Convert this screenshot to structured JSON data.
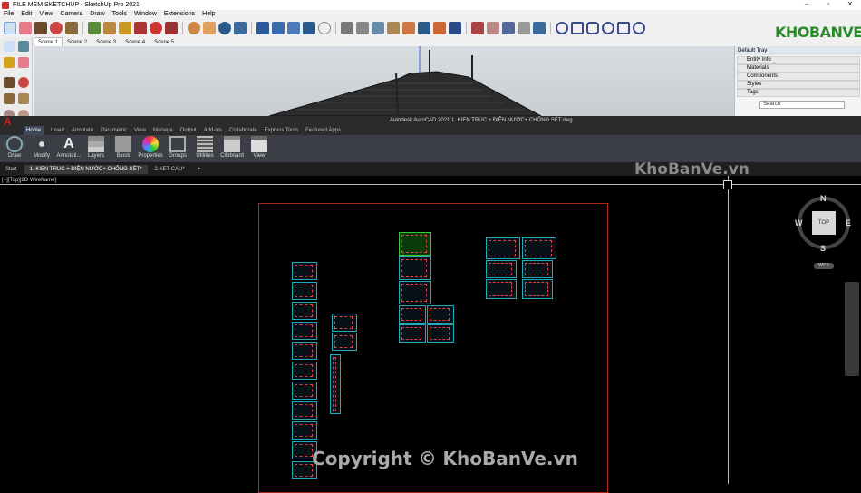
{
  "sketchup": {
    "title": "FILE MEM SKETCHUP - SketchUp Pro 2021",
    "menu": [
      "File",
      "Edit",
      "View",
      "Camera",
      "Draw",
      "Tools",
      "Window",
      "Extensions",
      "Help"
    ],
    "scenes": [
      "Scene 1",
      "Scene 2",
      "Scene 3",
      "Scene 4",
      "Scene 5"
    ],
    "tray": {
      "title": "Default Tray",
      "items": [
        "Entity Info",
        "Materials",
        "Components",
        "Styles",
        "Tags"
      ],
      "search_placeholder": "Search"
    }
  },
  "brand_logo_text": "KHOBANVE",
  "autocad": {
    "title": "Autodesk AutoCAD 2021   1. KIEN TRUC + ĐIỆN NƯỚC+ CHỐNG SÉT.dwg",
    "logo": "A",
    "ribbon_tabs": [
      "Home",
      "Insert",
      "Annotate",
      "Parametric",
      "View",
      "Manage",
      "Output",
      "Add-ins",
      "Collaborate",
      "Express Tools",
      "Featured Apps"
    ],
    "panels": [
      "Draw",
      "Modify",
      "Annotati...",
      "Layers",
      "Block",
      "Properties",
      "Groups",
      "Utilities",
      "Clipboard",
      "View"
    ],
    "doc_tabs": [
      "Start",
      "1. KIEN TRUC + ĐIỆN NƯỚC+ CHỐNG SÉT*",
      "2.KET CAU*"
    ],
    "viewport_label": "[−][Top][2D Wireframe]",
    "viewcube": {
      "n": "N",
      "s": "S",
      "e": "E",
      "w": "W",
      "face": "TOP",
      "wcs": "WCS"
    }
  },
  "watermark": "KhoBanVe.vn",
  "copyright": "Copyright © KhoBanVe.vn",
  "colors": {
    "brand_green": "#2a8a2a",
    "autocad_red": "#d31c1c",
    "ribbon": "#3b3f45"
  }
}
